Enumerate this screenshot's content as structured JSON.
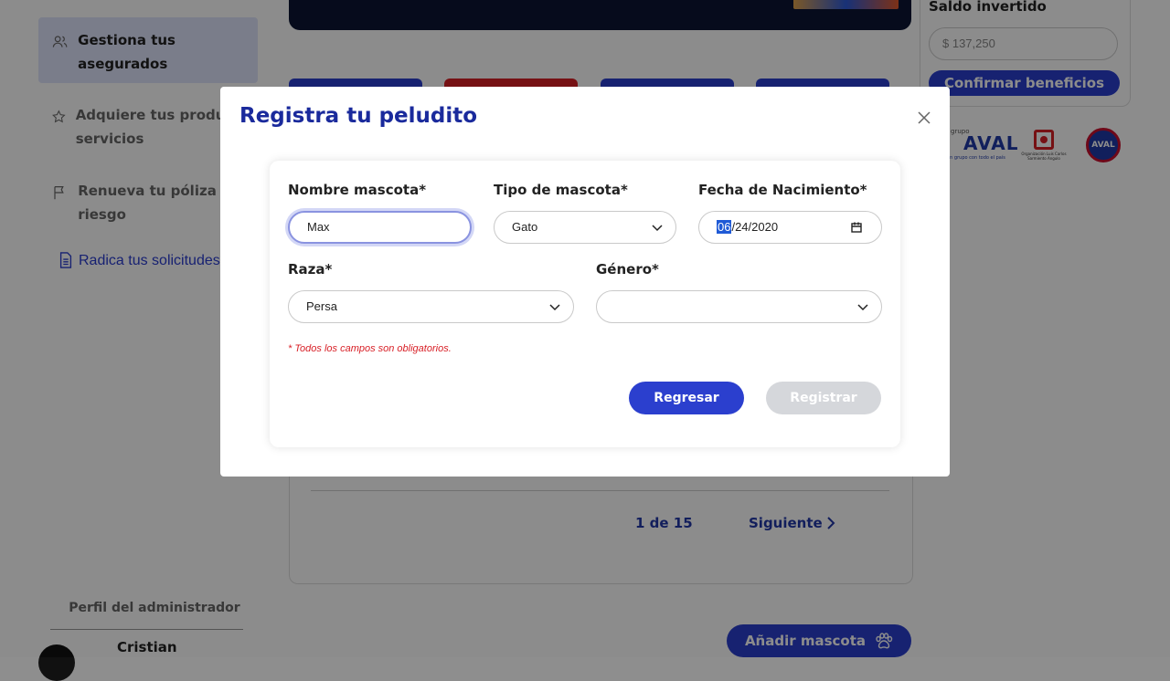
{
  "sidebar": {
    "items": [
      {
        "label": "Gestiona tus asegurados",
        "icon": "users-icon",
        "active": true
      },
      {
        "label": "Adquiere tus productos o servicios",
        "icon": "star-icon"
      },
      {
        "label": "Renueva tu póliza todo riesgo",
        "icon": "flag-icon"
      },
      {
        "label": "Radica tus solicitudes",
        "icon": "document-icon"
      }
    ],
    "profile_title": "Perfil del administrador",
    "profile_name": "Cristian"
  },
  "main": {
    "pager_info": "1 de 15",
    "pager_next": "Siguiente",
    "add_pet": "Añadir mascota"
  },
  "right": {
    "saldo_title": "Saldo invertido",
    "saldo_value": "$ 137,250",
    "confirm": "Confirmar beneficios",
    "logo_grupo_small": "grupo",
    "logo_grupo_big": "AVAL",
    "logo_grupo_sub": "un grupo con todo el país",
    "logo_org": "Organización Luis Carlos Sarmiento Angulo",
    "logo_aval": "AVAL"
  },
  "modal": {
    "title": "Registra tu peludito",
    "fields": {
      "name": {
        "label": "Nombre mascota*",
        "value": "Max"
      },
      "type": {
        "label": "Tipo de mascota*",
        "value": "Gato"
      },
      "birth": {
        "label": "Fecha de Nacimiento*",
        "month": "06",
        "rest": "/24/2020"
      },
      "breed": {
        "label": "Raza*",
        "value": "Persa"
      },
      "gender": {
        "label": "Género*",
        "value": ""
      }
    },
    "required_note": "* Todos los campos son obligatorios.",
    "back": "Regresar",
    "submit": "Registrar"
  },
  "colors": {
    "primary": "#2b3fce",
    "title": "#1a2a9c",
    "error": "#d81f26",
    "disabled": "#d5d7db"
  }
}
